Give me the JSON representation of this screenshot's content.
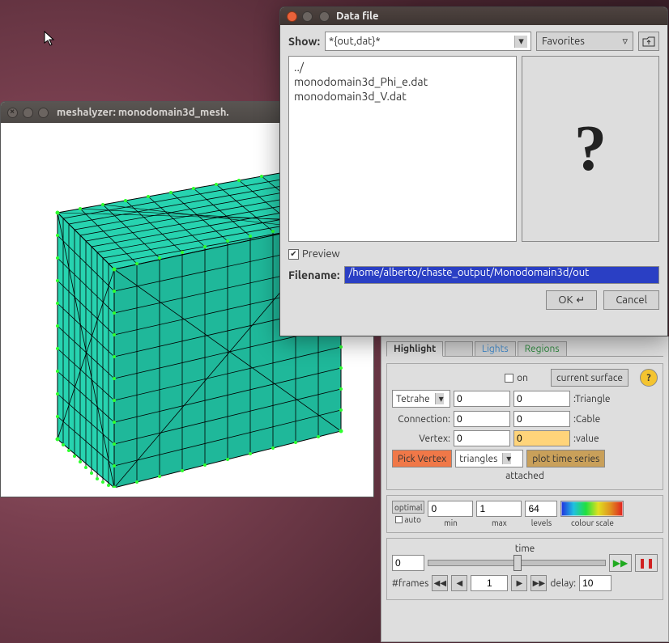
{
  "mesh_window": {
    "title": "meshalyzer: monodomain3d_mesh."
  },
  "dialog": {
    "title": "Data file",
    "show_label": "Show:",
    "show_pattern": "*{out,dat}*",
    "favorites_label": "Favorites",
    "files": {
      "parent": "../",
      "f1": "monodomain3d_Phi_e.dat",
      "f2": "monodomain3d_V.dat"
    },
    "preview_glyph": "?",
    "preview_check": "Preview",
    "filename_label": "Filename:",
    "filename_value": "/home/alberto/chaste_output/Monodomain3d/out",
    "ok": "OK",
    "cancel": "Cancel"
  },
  "panel": {
    "tabs": {
      "highlight": "Highlight",
      "unknown": "",
      "lights": "Lights",
      "regions": "Regions"
    },
    "on_label": "on",
    "current_surface": "current surface",
    "element_type": "Tetrahe",
    "elem_v1": "0",
    "elem_v2": "0",
    "elem_unit": ":Triangle",
    "connection_label": "Connection:",
    "conn_v1": "0",
    "conn_v2": "0",
    "conn_unit": ":Cable",
    "vertex_label": "Vertex:",
    "vertex_v1": "0",
    "vertex_v2": "0",
    "vertex_unit": ":value",
    "pick_vertex": "Pick Vertex",
    "triangles": "triangles",
    "plot_ts": "plot time series",
    "attached": "attached",
    "optimal": "optimal",
    "auto": "auto",
    "min": "0",
    "max": "1",
    "levels": "64",
    "min_l": "min",
    "max_l": "max",
    "levels_l": "levels",
    "colour_l": "colour scale",
    "time_label": "time",
    "time_val": "0",
    "frames_label": "#frames",
    "frame_num": "1",
    "delay_label": "delay:",
    "delay_val": "10"
  }
}
